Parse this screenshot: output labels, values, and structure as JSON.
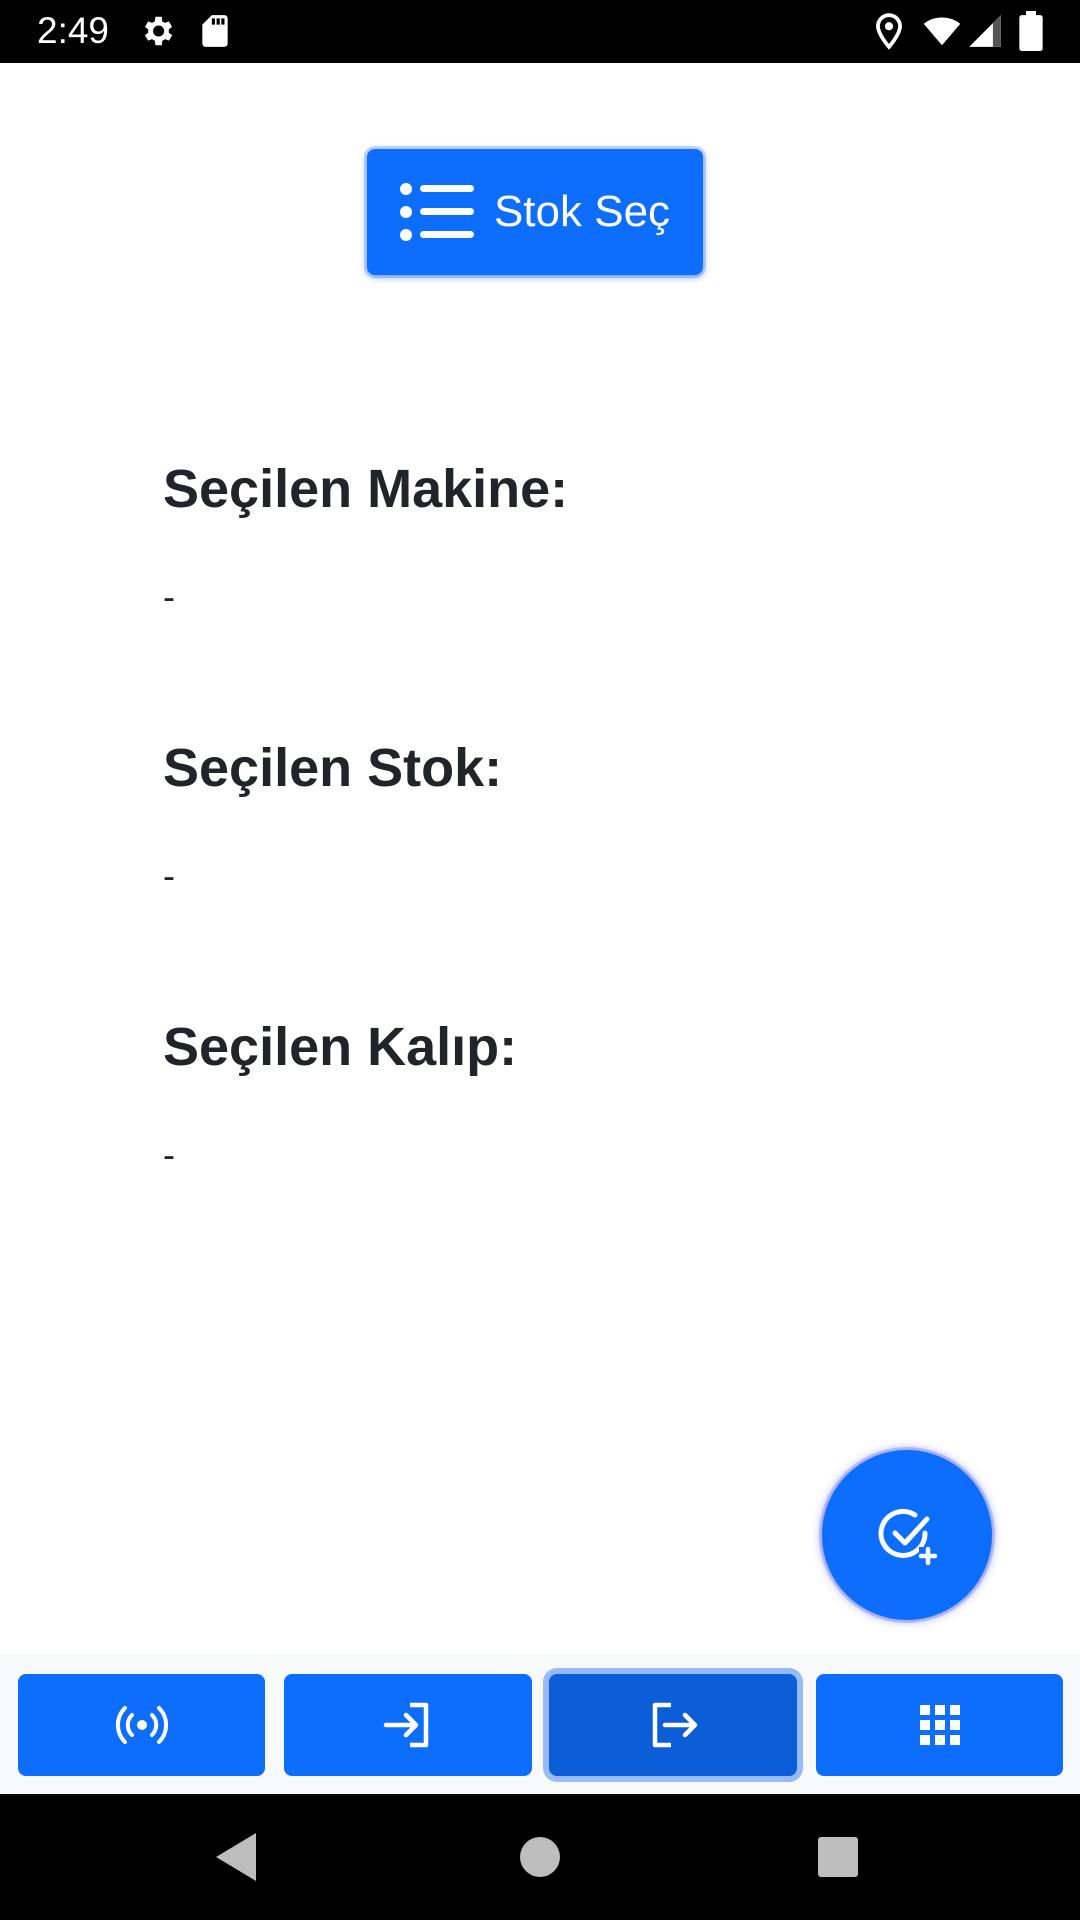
{
  "status_bar": {
    "time": "2:49",
    "icons": [
      "settings-icon",
      "sd-card-icon",
      "location-icon",
      "wifi-icon",
      "signal-icon",
      "battery-icon"
    ]
  },
  "stok_button": {
    "label": "Stok Seç",
    "icon": "list-icon"
  },
  "sections": [
    {
      "title": "Seçilen Makine:",
      "value": "-"
    },
    {
      "title": "Seçilen Stok:",
      "value": "-"
    },
    {
      "title": "Seçilen Kalıp:",
      "value": "-"
    }
  ],
  "fab": {
    "icon": "check-circle-plus-icon"
  },
  "tab_bar": {
    "tabs": [
      {
        "icon": "broadcast-icon",
        "active": false
      },
      {
        "icon": "login-icon",
        "active": false
      },
      {
        "icon": "logout-icon",
        "active": true
      },
      {
        "icon": "grid-icon",
        "active": false
      }
    ]
  },
  "nav_bar": {
    "buttons": [
      "back-icon",
      "home-icon",
      "recents-icon"
    ]
  },
  "colors": {
    "primary": "#0d6efd",
    "primary_active": "#0b5ed7",
    "text": "#212529",
    "status_bar": "#000000"
  }
}
